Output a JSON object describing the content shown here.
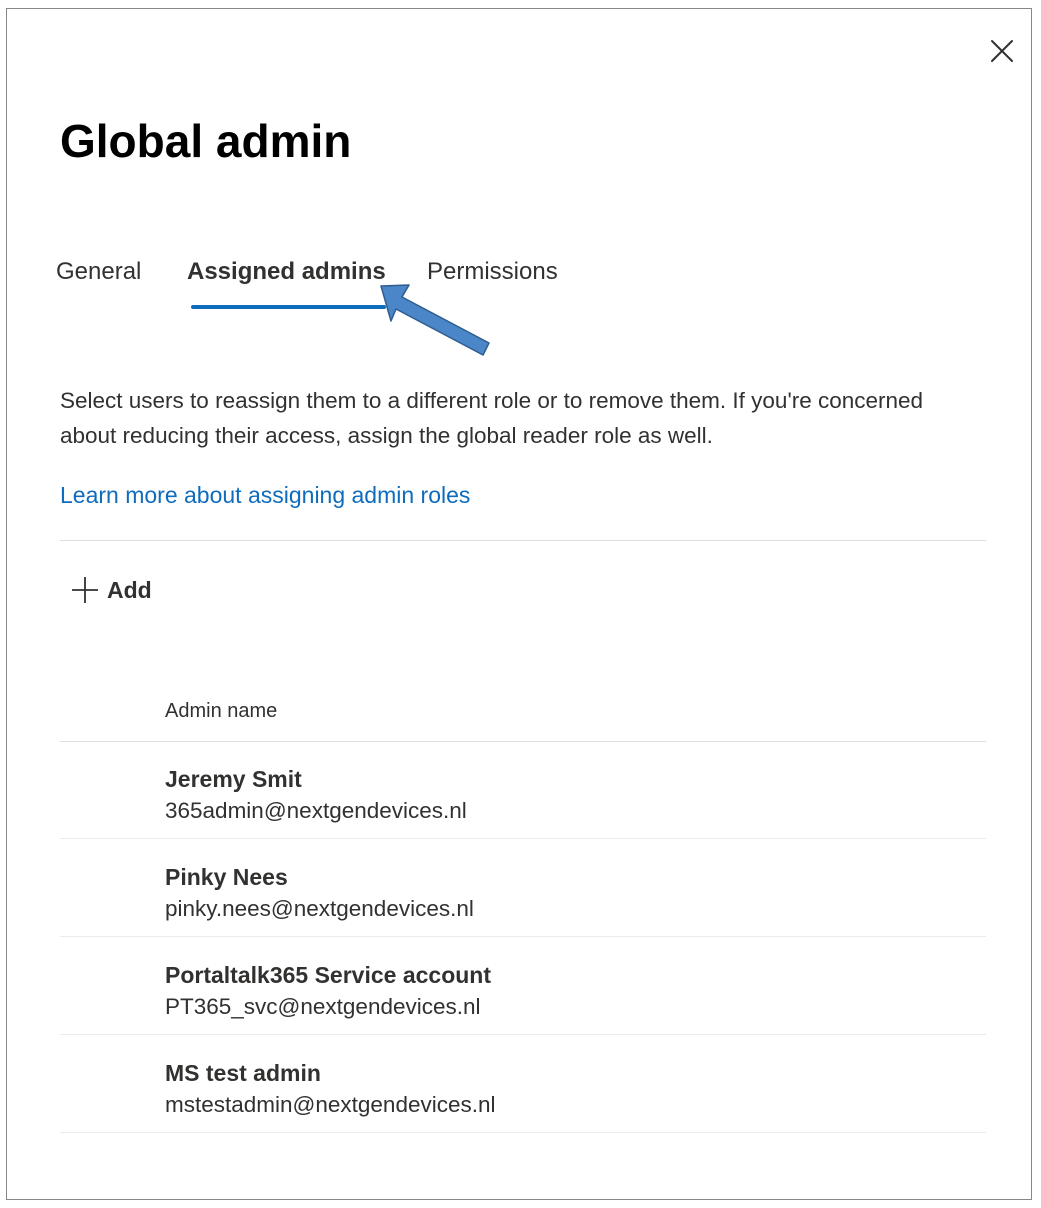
{
  "panel": {
    "title": "Global admin",
    "close_icon": "close-icon"
  },
  "tabs": [
    {
      "label": "General",
      "active": false
    },
    {
      "label": "Assigned admins",
      "active": true
    },
    {
      "label": "Permissions",
      "active": false
    }
  ],
  "description": "Select users to reassign them to a different role or to remove them. If you're concerned about reducing their access, assign the global reader role as well.",
  "learn_more_link": "Learn more about assigning admin roles",
  "toolbar": {
    "add_label": "Add",
    "add_icon": "plus-icon"
  },
  "table": {
    "column_header": "Admin name",
    "rows": [
      {
        "name": "Jeremy Smit",
        "email": "365admin@nextgendevices.nl"
      },
      {
        "name": "Pinky Nees",
        "email": "pinky.nees@nextgendevices.nl"
      },
      {
        "name": "Portaltalk365 Service account",
        "email": "PT365_svc@nextgendevices.nl"
      },
      {
        "name": "MS test admin",
        "email": "mstestadmin@nextgendevices.nl"
      }
    ]
  },
  "colors": {
    "accent": "#0f6cbd",
    "annotation_arrow": "#4a86c8",
    "text": "#323130"
  }
}
